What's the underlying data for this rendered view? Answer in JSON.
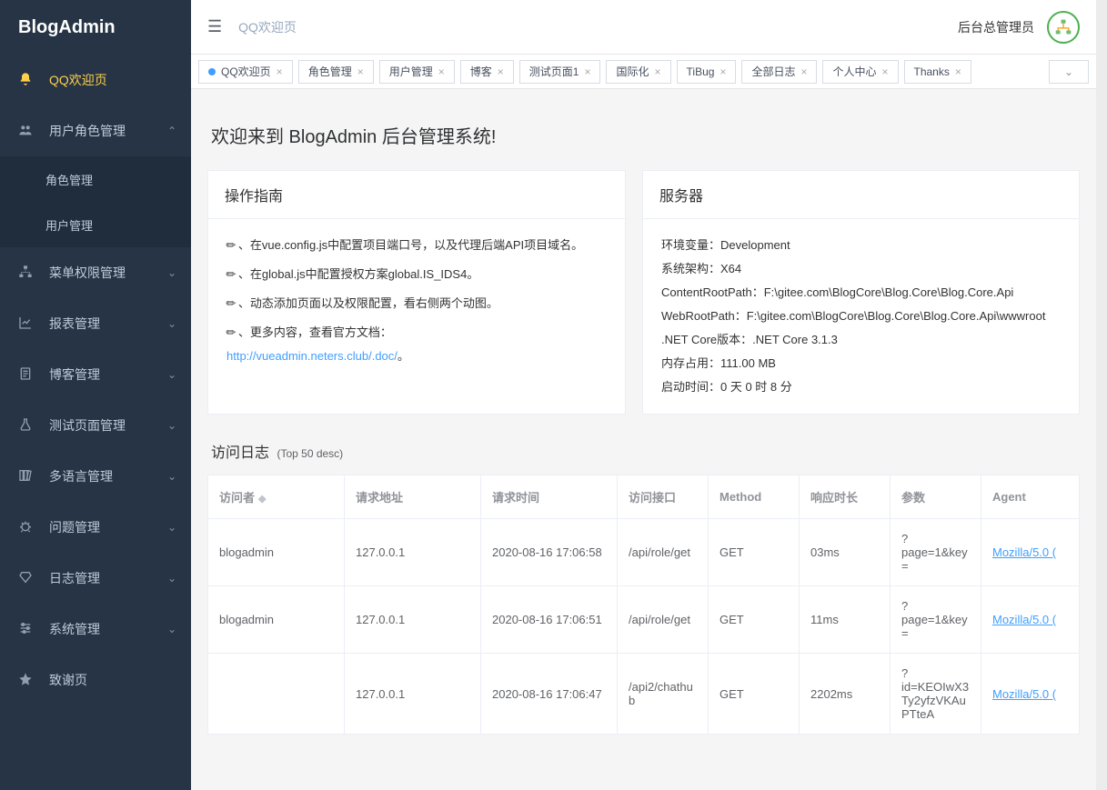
{
  "logo": "BlogAdmin",
  "sidebar": {
    "items": [
      {
        "label": "QQ欢迎页",
        "icon": "bell",
        "active": true
      },
      {
        "label": "用户角色管理",
        "icon": "users",
        "chev": "up",
        "children": [
          {
            "label": "角色管理"
          },
          {
            "label": "用户管理"
          }
        ]
      },
      {
        "label": "菜单权限管理",
        "icon": "sitemap",
        "chev": "down"
      },
      {
        "label": "报表管理",
        "icon": "chart",
        "chev": "down"
      },
      {
        "label": "博客管理",
        "icon": "doc",
        "chev": "down"
      },
      {
        "label": "测试页面管理",
        "icon": "flask",
        "chev": "down"
      },
      {
        "label": "多语言管理",
        "icon": "books",
        "chev": "down"
      },
      {
        "label": "问题管理",
        "icon": "bug",
        "chev": "down"
      },
      {
        "label": "日志管理",
        "icon": "diamond",
        "chev": "down"
      },
      {
        "label": "系统管理",
        "icon": "sliders",
        "chev": "down"
      },
      {
        "label": "致谢页",
        "icon": "star"
      }
    ]
  },
  "header": {
    "breadcrumb": "QQ欢迎页",
    "user": "后台总管理员"
  },
  "tabs": [
    {
      "label": "QQ欢迎页",
      "active": true,
      "closable": true
    },
    {
      "label": "角色管理",
      "closable": true
    },
    {
      "label": "用户管理",
      "closable": true
    },
    {
      "label": "博客",
      "closable": true
    },
    {
      "label": "测试页面1",
      "closable": true
    },
    {
      "label": "国际化",
      "closable": true
    },
    {
      "label": "TiBug",
      "closable": true
    },
    {
      "label": "全部日志",
      "closable": true
    },
    {
      "label": "个人中心",
      "closable": true
    },
    {
      "label": "Thanks",
      "closable": true
    }
  ],
  "welcome_title": "欢迎来到 BlogAdmin 后台管理系统!",
  "guide": {
    "title": "操作指南",
    "lines": [
      "在vue.config.js中配置项目端口号，以及代理后端API项目域名。",
      "在global.js中配置授权方案global.IS_IDS4。",
      "动态添加页面以及权限配置，看右侧两个动图。",
      "更多内容，查看官方文档："
    ],
    "doc_link": "http://vueadmin.neters.club/.doc/",
    "doc_link_suffix": "。"
  },
  "server": {
    "title": "服务器",
    "lines": [
      "环境变量：Development",
      "系统架构：X64",
      "ContentRootPath：F:\\gitee.com\\BlogCore\\Blog.Core\\Blog.Core.Api",
      "WebRootPath：F:\\gitee.com\\BlogCore\\Blog.Core\\Blog.Core.Api\\wwwroot",
      ".NET Core版本：.NET Core 3.1.3",
      "内存占用：111.00 MB",
      "启动时间：0 天 0 时 8 分"
    ]
  },
  "log": {
    "title": "访问日志",
    "subtitle": "(Top 50 desc)",
    "columns": [
      "访问者",
      "请求地址",
      "请求时间",
      "访问接口",
      "Method",
      "响应时长",
      "参数",
      "Agent"
    ],
    "rows": [
      {
        "user": "blogadmin",
        "ip": "127.0.0.1",
        "time": "2020-08-16 17:06:58",
        "api": "/api/role/get",
        "method": "GET",
        "dur": "03ms",
        "params": "?page=1&key=",
        "agent": "Mozilla/5.0 ("
      },
      {
        "user": "blogadmin",
        "ip": "127.0.0.1",
        "time": "2020-08-16 17:06:51",
        "api": "/api/role/get",
        "method": "GET",
        "dur": "11ms",
        "params": "?page=1&key=",
        "agent": "Mozilla/5.0 ("
      },
      {
        "user": "",
        "ip": "127.0.0.1",
        "time": "2020-08-16 17:06:47",
        "api": "/api2/chathub",
        "method": "GET",
        "dur": "2202ms",
        "params": "?id=KEOIwX3Ty2yfzVKAuPTteA",
        "agent": "Mozilla/5.0 ("
      }
    ]
  }
}
